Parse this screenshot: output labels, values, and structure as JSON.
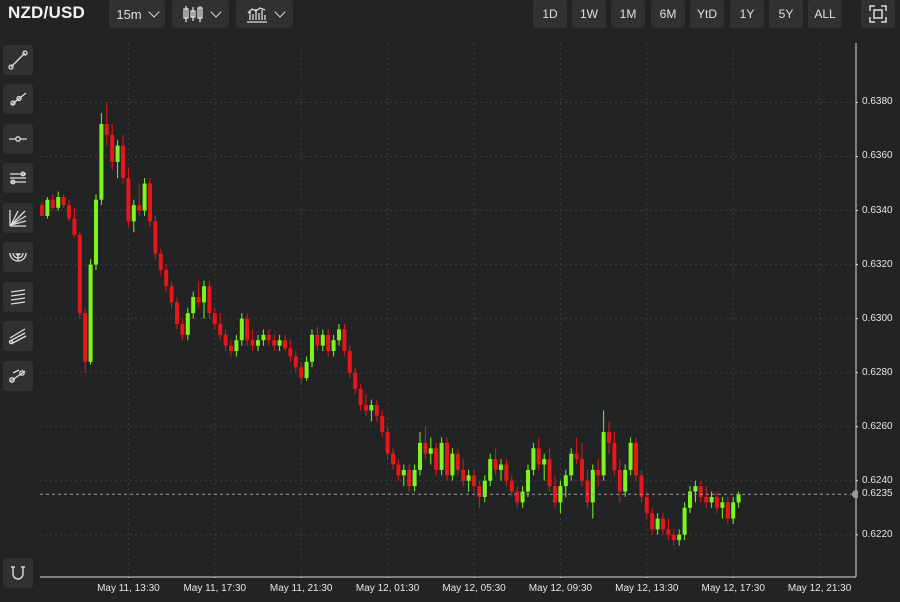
{
  "header": {
    "symbol": "NZD/USD",
    "interval": "15m",
    "chart_type_icon": "candlestick-icon",
    "indicator_icon": "bar-chart-icon",
    "ranges": [
      "1D",
      "1W",
      "1M",
      "6M",
      "YtD",
      "1Y",
      "5Y",
      "ALL"
    ],
    "fullscreen_icon": "fullscreen-icon"
  },
  "sidebar": {
    "tools": [
      {
        "name": "trend-line-icon"
      },
      {
        "name": "ray-line-icon"
      },
      {
        "name": "horizontal-line-icon"
      },
      {
        "name": "parallel-channel-icon"
      },
      {
        "name": "fibonacci-fan-icon"
      },
      {
        "name": "fibonacci-arcs-icon"
      },
      {
        "name": "fibonacci-retracement-icon"
      },
      {
        "name": "pitchfork-icon"
      },
      {
        "name": "measure-line-icon"
      }
    ],
    "magnet_icon": "magnet-icon"
  },
  "colors": {
    "up": "#7cf51f",
    "down": "#e81519",
    "background": "#222324",
    "grid": "#3a3c3e",
    "axis_text": "#e6e6e6"
  },
  "chart_data": {
    "type": "candlestick",
    "ylim": [
      0.6204,
      0.6402
    ],
    "yticks": [
      0.622,
      0.624,
      0.626,
      0.628,
      0.63,
      0.632,
      0.634,
      0.636,
      0.638
    ],
    "ytick_labels": [
      "0.6220",
      "0.6240",
      "0.6260",
      "0.6280",
      "0.6300",
      "0.6320",
      "0.6340",
      "0.6360",
      "0.6380"
    ],
    "xtick_labels": [
      "May 11, 13:30",
      "May 11, 17:30",
      "May 11, 21:30",
      "May 12, 01:30",
      "May 12, 05:30",
      "May 12, 09:30",
      "May 12, 13:30",
      "May 12, 17:30",
      "May 12, 21:30"
    ],
    "xtick_index": [
      16,
      32,
      48,
      64,
      80,
      96,
      112,
      128,
      144
    ],
    "last_price": 0.6235,
    "last_price_label": "0.6235",
    "candles": [
      [
        0.6342,
        0.6343,
        0.6338,
        0.6338
      ],
      [
        0.6338,
        0.6345,
        0.6337,
        0.6344
      ],
      [
        0.6344,
        0.6346,
        0.634,
        0.6341
      ],
      [
        0.6341,
        0.6347,
        0.634,
        0.6345
      ],
      [
        0.6345,
        0.6346,
        0.6341,
        0.6342
      ],
      [
        0.6342,
        0.6344,
        0.6336,
        0.6337
      ],
      [
        0.6337,
        0.6341,
        0.633,
        0.6331
      ],
      [
        0.6331,
        0.6332,
        0.63,
        0.6302
      ],
      [
        0.6302,
        0.6304,
        0.628,
        0.6284
      ],
      [
        0.6284,
        0.6322,
        0.6283,
        0.632
      ],
      [
        0.632,
        0.6346,
        0.6318,
        0.6344
      ],
      [
        0.6344,
        0.6376,
        0.6342,
        0.6372
      ],
      [
        0.6372,
        0.638,
        0.6364,
        0.6368
      ],
      [
        0.6368,
        0.6372,
        0.6355,
        0.6358
      ],
      [
        0.6358,
        0.6366,
        0.6352,
        0.6364
      ],
      [
        0.6364,
        0.6368,
        0.635,
        0.6352
      ],
      [
        0.6352,
        0.6356,
        0.6334,
        0.6336
      ],
      [
        0.6336,
        0.6344,
        0.6332,
        0.6342
      ],
      [
        0.6342,
        0.635,
        0.6338,
        0.634
      ],
      [
        0.634,
        0.6352,
        0.6338,
        0.635
      ],
      [
        0.635,
        0.6352,
        0.6334,
        0.6336
      ],
      [
        0.6336,
        0.6338,
        0.6322,
        0.6324
      ],
      [
        0.6324,
        0.6326,
        0.6316,
        0.6318
      ],
      [
        0.6318,
        0.632,
        0.631,
        0.6312
      ],
      [
        0.6312,
        0.6314,
        0.6304,
        0.6306
      ],
      [
        0.6306,
        0.6308,
        0.6296,
        0.6298
      ],
      [
        0.6298,
        0.63,
        0.6292,
        0.6294
      ],
      [
        0.6294,
        0.6304,
        0.6292,
        0.6302
      ],
      [
        0.6302,
        0.631,
        0.63,
        0.6308
      ],
      [
        0.6308,
        0.6314,
        0.6304,
        0.6306
      ],
      [
        0.6306,
        0.6314,
        0.63,
        0.6312
      ],
      [
        0.6312,
        0.6314,
        0.63,
        0.6302
      ],
      [
        0.6302,
        0.6304,
        0.6296,
        0.6298
      ],
      [
        0.6298,
        0.6302,
        0.6292,
        0.6294
      ],
      [
        0.6294,
        0.6296,
        0.6288,
        0.629
      ],
      [
        0.629,
        0.6292,
        0.6286,
        0.6288
      ],
      [
        0.6288,
        0.6294,
        0.6286,
        0.6292
      ],
      [
        0.6292,
        0.6302,
        0.629,
        0.63
      ],
      [
        0.63,
        0.6302,
        0.629,
        0.6292
      ],
      [
        0.6292,
        0.6296,
        0.6288,
        0.629
      ],
      [
        0.629,
        0.6294,
        0.6288,
        0.6292
      ],
      [
        0.6292,
        0.6296,
        0.629,
        0.6294
      ],
      [
        0.6294,
        0.6296,
        0.629,
        0.6292
      ],
      [
        0.6292,
        0.6294,
        0.6288,
        0.629
      ],
      [
        0.629,
        0.6294,
        0.6288,
        0.6292
      ],
      [
        0.6292,
        0.6294,
        0.6288,
        0.6289
      ],
      [
        0.6289,
        0.6292,
        0.6284,
        0.6286
      ],
      [
        0.6286,
        0.6288,
        0.628,
        0.6282
      ],
      [
        0.6282,
        0.6284,
        0.6276,
        0.6278
      ],
      [
        0.6278,
        0.6286,
        0.6277,
        0.6284
      ],
      [
        0.6284,
        0.6296,
        0.6282,
        0.6294
      ],
      [
        0.6294,
        0.6297,
        0.6288,
        0.629
      ],
      [
        0.629,
        0.6296,
        0.6288,
        0.6294
      ],
      [
        0.6294,
        0.6296,
        0.6286,
        0.6288
      ],
      [
        0.6288,
        0.6294,
        0.6286,
        0.6292
      ],
      [
        0.6292,
        0.6298,
        0.629,
        0.6296
      ],
      [
        0.6296,
        0.6298,
        0.6286,
        0.6288
      ],
      [
        0.6288,
        0.629,
        0.6278,
        0.628
      ],
      [
        0.628,
        0.6282,
        0.6272,
        0.6274
      ],
      [
        0.6274,
        0.6276,
        0.6266,
        0.6268
      ],
      [
        0.6268,
        0.6272,
        0.6264,
        0.6266
      ],
      [
        0.6266,
        0.627,
        0.6262,
        0.6268
      ],
      [
        0.6268,
        0.627,
        0.6262,
        0.6264
      ],
      [
        0.6264,
        0.6266,
        0.6256,
        0.6258
      ],
      [
        0.6258,
        0.626,
        0.6248,
        0.625
      ],
      [
        0.625,
        0.6252,
        0.6244,
        0.6246
      ],
      [
        0.6246,
        0.6248,
        0.624,
        0.6242
      ],
      [
        0.6242,
        0.6246,
        0.6238,
        0.6244
      ],
      [
        0.6244,
        0.6246,
        0.6236,
        0.6238
      ],
      [
        0.6238,
        0.6246,
        0.6236,
        0.6244
      ],
      [
        0.6244,
        0.6258,
        0.6242,
        0.6254
      ],
      [
        0.6254,
        0.626,
        0.6248,
        0.625
      ],
      [
        0.625,
        0.6256,
        0.6246,
        0.6252
      ],
      [
        0.6252,
        0.6254,
        0.6242,
        0.6244
      ],
      [
        0.6244,
        0.6256,
        0.6242,
        0.6254
      ],
      [
        0.6254,
        0.6256,
        0.624,
        0.6242
      ],
      [
        0.6242,
        0.6252,
        0.624,
        0.625
      ],
      [
        0.625,
        0.6252,
        0.6242,
        0.6244
      ],
      [
        0.6244,
        0.6248,
        0.6238,
        0.624
      ],
      [
        0.624,
        0.6244,
        0.6236,
        0.6242
      ],
      [
        0.6242,
        0.6244,
        0.6236,
        0.6238
      ],
      [
        0.6238,
        0.624,
        0.623,
        0.6234
      ],
      [
        0.6234,
        0.6242,
        0.6232,
        0.624
      ],
      [
        0.624,
        0.625,
        0.6238,
        0.6248
      ],
      [
        0.6248,
        0.6252,
        0.6242,
        0.6244
      ],
      [
        0.6244,
        0.6248,
        0.624,
        0.6246
      ],
      [
        0.6246,
        0.6248,
        0.6238,
        0.624
      ],
      [
        0.624,
        0.6242,
        0.6234,
        0.6236
      ],
      [
        0.6236,
        0.6238,
        0.623,
        0.6232
      ],
      [
        0.6232,
        0.6238,
        0.623,
        0.6236
      ],
      [
        0.6236,
        0.6246,
        0.6234,
        0.6244
      ],
      [
        0.6244,
        0.6254,
        0.6242,
        0.6252
      ],
      [
        0.6252,
        0.6256,
        0.6244,
        0.6246
      ],
      [
        0.6246,
        0.625,
        0.624,
        0.6248
      ],
      [
        0.6248,
        0.6252,
        0.6236,
        0.6238
      ],
      [
        0.6238,
        0.6242,
        0.623,
        0.6232
      ],
      [
        0.6232,
        0.624,
        0.6228,
        0.6238
      ],
      [
        0.6238,
        0.6244,
        0.6234,
        0.6242
      ],
      [
        0.6242,
        0.6252,
        0.624,
        0.625
      ],
      [
        0.625,
        0.6256,
        0.6246,
        0.6248
      ],
      [
        0.6248,
        0.6254,
        0.6238,
        0.624
      ],
      [
        0.624,
        0.6244,
        0.623,
        0.6232
      ],
      [
        0.6232,
        0.6246,
        0.6226,
        0.6244
      ],
      [
        0.6244,
        0.6248,
        0.6238,
        0.6242
      ],
      [
        0.6242,
        0.6266,
        0.624,
        0.6258
      ],
      [
        0.6258,
        0.6262,
        0.625,
        0.6254
      ],
      [
        0.6254,
        0.6258,
        0.6242,
        0.6244
      ],
      [
        0.6244,
        0.6248,
        0.6232,
        0.6236
      ],
      [
        0.6236,
        0.6246,
        0.6234,
        0.6244
      ],
      [
        0.6244,
        0.6256,
        0.6242,
        0.6254
      ],
      [
        0.6254,
        0.6256,
        0.624,
        0.6242
      ],
      [
        0.6242,
        0.6244,
        0.6232,
        0.6234
      ],
      [
        0.6234,
        0.6236,
        0.6226,
        0.6228
      ],
      [
        0.6228,
        0.623,
        0.622,
        0.6222
      ],
      [
        0.6222,
        0.6228,
        0.622,
        0.6226
      ],
      [
        0.6226,
        0.6228,
        0.622,
        0.6222
      ],
      [
        0.6222,
        0.6226,
        0.6218,
        0.622
      ],
      [
        0.622,
        0.6222,
        0.6216,
        0.6218
      ],
      [
        0.6218,
        0.6222,
        0.6216,
        0.622
      ],
      [
        0.622,
        0.6232,
        0.6218,
        0.623
      ],
      [
        0.623,
        0.6238,
        0.6228,
        0.6236
      ],
      [
        0.6236,
        0.624,
        0.6232,
        0.6238
      ],
      [
        0.6238,
        0.624,
        0.6232,
        0.6234
      ],
      [
        0.6234,
        0.6238,
        0.623,
        0.6232
      ],
      [
        0.6232,
        0.6236,
        0.623,
        0.6234
      ],
      [
        0.6234,
        0.6236,
        0.6228,
        0.623
      ],
      [
        0.623,
        0.6234,
        0.6226,
        0.6232
      ],
      [
        0.6232,
        0.6234,
        0.6224,
        0.6226
      ],
      [
        0.6226,
        0.6234,
        0.6224,
        0.6232
      ],
      [
        0.6232,
        0.6236,
        0.623,
        0.6235
      ]
    ]
  }
}
